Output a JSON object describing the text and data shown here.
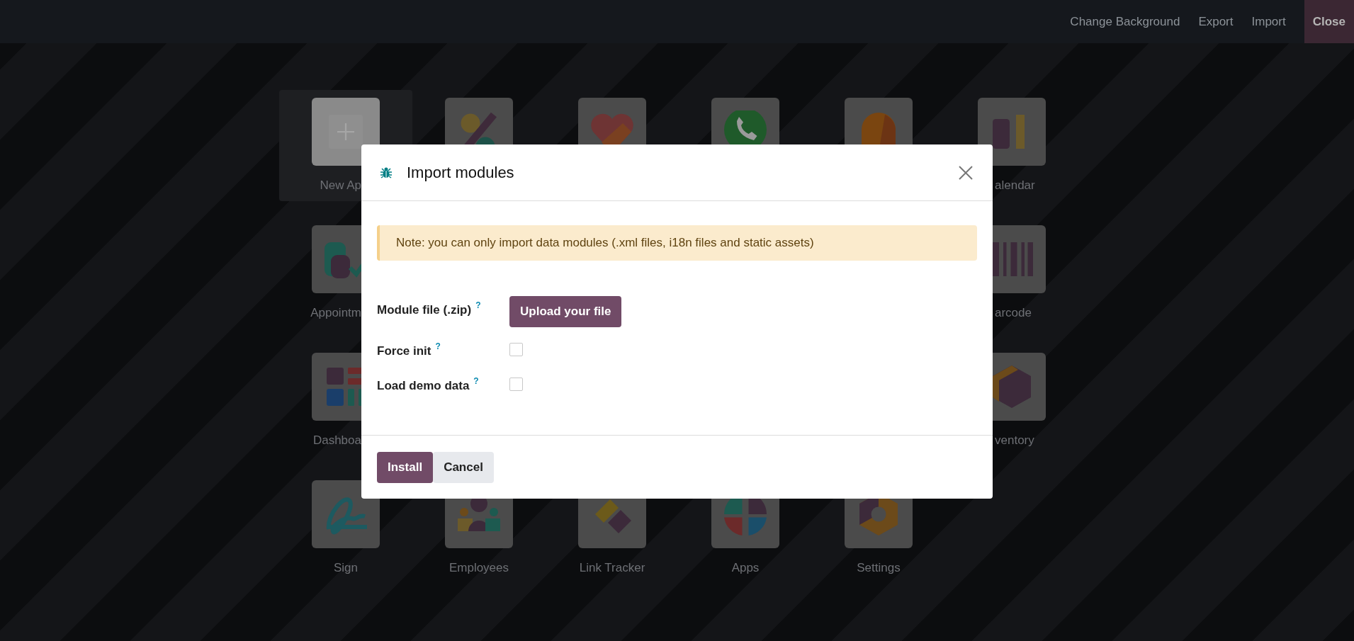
{
  "top_bar": {
    "actions": [
      {
        "label": "Change Background",
        "kind": "link"
      },
      {
        "label": "Export",
        "kind": "link"
      },
      {
        "label": "Import",
        "kind": "link"
      },
      {
        "label": "Close",
        "kind": "close"
      }
    ]
  },
  "apps": [
    [
      {
        "kind": "new",
        "label": "New Ap",
        "selected": true
      },
      {
        "kind": "app",
        "selected": false
      },
      {
        "kind": "app",
        "selected": false
      },
      {
        "kind": "app",
        "selected": false
      },
      {
        "kind": "app",
        "selected": false
      },
      {
        "kind": "app",
        "label": "alendar",
        "selected": false
      }
    ],
    [
      {
        "kind": "app",
        "label": "Appointm",
        "selected": false
      },
      {
        "kind": "app",
        "label": "arcode",
        "selected": false
      }
    ],
    [
      {
        "kind": "app",
        "label": "Dashboa",
        "selected": false
      },
      {
        "kind": "app",
        "label": "ventory",
        "selected": false
      }
    ],
    [
      {
        "kind": "app",
        "label": "Sign",
        "selected": false
      },
      {
        "kind": "app",
        "label": "Employees",
        "selected": false
      },
      {
        "kind": "app",
        "label": "Link Tracker",
        "selected": false
      },
      {
        "kind": "app",
        "label": "Apps",
        "selected": false
      },
      {
        "kind": "app",
        "label": "Settings",
        "selected": false
      }
    ]
  ],
  "dialog": {
    "title": "Import modules",
    "note": "Note: you can only import data modules (.xml files, i18n files and static assets)",
    "fields": [
      {
        "kind": "upload",
        "label": "Module file (.zip)",
        "help": "?",
        "button": "Upload your file"
      },
      {
        "kind": "checkbox",
        "label": "Force init",
        "help": "?",
        "checked": false
      },
      {
        "kind": "checkbox",
        "label": "Load demo data",
        "help": "?",
        "checked": false
      }
    ],
    "buttons": [
      {
        "label": "Install",
        "kind": "primary"
      },
      {
        "label": "Cancel",
        "kind": "secondary"
      }
    ]
  }
}
